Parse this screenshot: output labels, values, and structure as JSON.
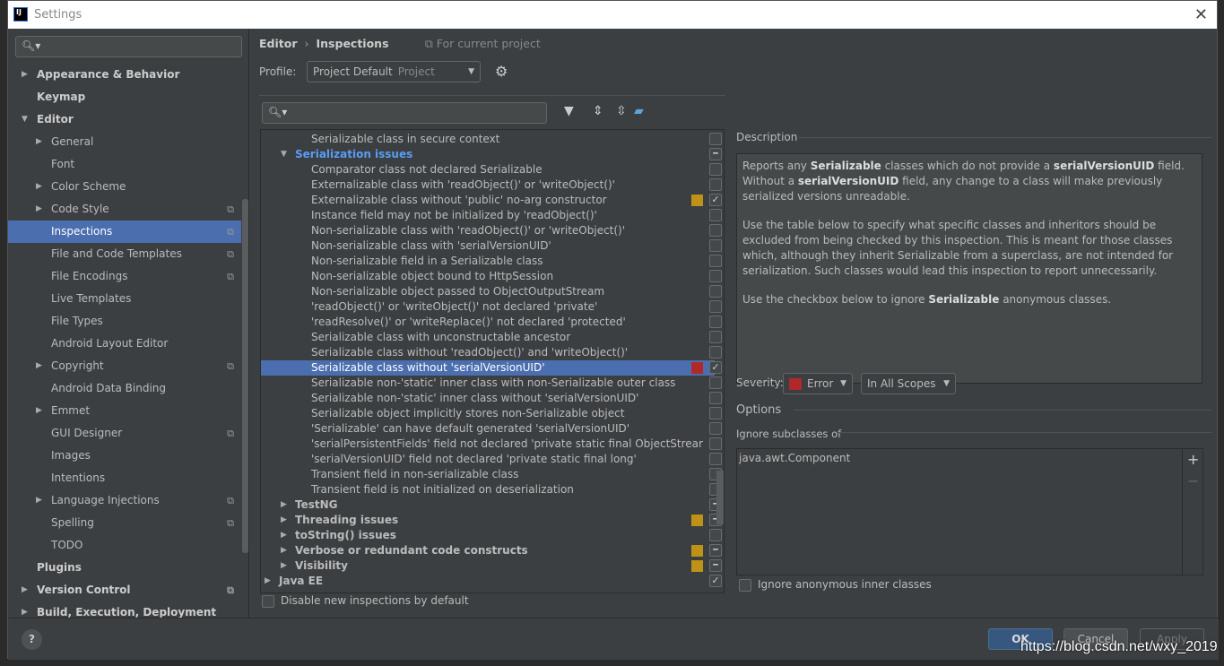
{
  "window": {
    "title": "Settings",
    "logo": "IJ"
  },
  "sidebar": {
    "items": [
      {
        "label": "Appearance & Behavior",
        "level": 0,
        "arrow": "right"
      },
      {
        "label": "Keymap",
        "level": 0
      },
      {
        "label": "Editor",
        "level": 0,
        "arrow": "down"
      },
      {
        "label": "General",
        "level": 1,
        "arrow": "right"
      },
      {
        "label": "Font",
        "level": 1
      },
      {
        "label": "Color Scheme",
        "level": 1,
        "arrow": "right"
      },
      {
        "label": "Code Style",
        "level": 1,
        "arrow": "right",
        "project": true
      },
      {
        "label": "Inspections",
        "level": 1,
        "project": true,
        "selected": true
      },
      {
        "label": "File and Code Templates",
        "level": 1,
        "project": true
      },
      {
        "label": "File Encodings",
        "level": 1,
        "project": true
      },
      {
        "label": "Live Templates",
        "level": 1
      },
      {
        "label": "File Types",
        "level": 1
      },
      {
        "label": "Android Layout Editor",
        "level": 1
      },
      {
        "label": "Copyright",
        "level": 1,
        "arrow": "right",
        "project": true
      },
      {
        "label": "Android Data Binding",
        "level": 1
      },
      {
        "label": "Emmet",
        "level": 1,
        "arrow": "right"
      },
      {
        "label": "GUI Designer",
        "level": 1,
        "project": true
      },
      {
        "label": "Images",
        "level": 1
      },
      {
        "label": "Intentions",
        "level": 1
      },
      {
        "label": "Language Injections",
        "level": 1,
        "arrow": "right",
        "project": true
      },
      {
        "label": "Spelling",
        "level": 1,
        "project": true
      },
      {
        "label": "TODO",
        "level": 1
      },
      {
        "label": "Plugins",
        "level": 0
      },
      {
        "label": "Version Control",
        "level": 0,
        "arrow": "right",
        "project": true
      },
      {
        "label": "Build, Execution, Deployment",
        "level": 0,
        "arrow": "right"
      }
    ]
  },
  "header": {
    "crumb1": "Editor",
    "crumb2": "Inspections",
    "for_project": "For current project"
  },
  "profile": {
    "label": "Profile:",
    "value": "Project Default",
    "sub": "Project"
  },
  "colors": {
    "warning": "#be9117",
    "error": "#b0282a",
    "accent": "#4b6eaf",
    "link": "#589df6"
  },
  "tree": [
    {
      "label": "Serializable class in secure context",
      "depth": 2,
      "check": "empty"
    },
    {
      "label": "Serialization issues",
      "depth": 1,
      "arrow": "down",
      "check": "partial",
      "highlight": true
    },
    {
      "label": "Comparator class not declared Serializable",
      "depth": 2,
      "check": "empty"
    },
    {
      "label": "Externalizable class with 'readObject()' or 'writeObject()'",
      "depth": 2,
      "check": "empty"
    },
    {
      "label": "Externalizable class without 'public' no-arg constructor",
      "depth": 2,
      "check": "checked",
      "severity": "warning"
    },
    {
      "label": "Instance field may not be initialized by 'readObject()'",
      "depth": 2,
      "check": "empty"
    },
    {
      "label": "Non-serializable class with 'readObject()' or 'writeObject()'",
      "depth": 2,
      "check": "empty"
    },
    {
      "label": "Non-serializable class with 'serialVersionUID'",
      "depth": 2,
      "check": "empty"
    },
    {
      "label": "Non-serializable field in a Serializable class",
      "depth": 2,
      "check": "empty"
    },
    {
      "label": "Non-serializable object bound to HttpSession",
      "depth": 2,
      "check": "empty"
    },
    {
      "label": "Non-serializable object passed to ObjectOutputStream",
      "depth": 2,
      "check": "empty"
    },
    {
      "label": "'readObject()' or 'writeObject()' not declared 'private'",
      "depth": 2,
      "check": "empty"
    },
    {
      "label": "'readResolve()' or 'writeReplace()' not declared 'protected'",
      "depth": 2,
      "check": "empty"
    },
    {
      "label": "Serializable class with unconstructable ancestor",
      "depth": 2,
      "check": "empty"
    },
    {
      "label": "Serializable class without 'readObject()' and 'writeObject()'",
      "depth": 2,
      "check": "empty"
    },
    {
      "label": "Serializable class without 'serialVersionUID'",
      "depth": 2,
      "check": "checked",
      "severity": "error",
      "selected": true
    },
    {
      "label": "Serializable non-'static' inner class with non-Serializable outer class",
      "depth": 2,
      "check": "empty"
    },
    {
      "label": "Serializable non-'static' inner class without 'serialVersionUID'",
      "depth": 2,
      "check": "empty"
    },
    {
      "label": "Serializable object implicitly stores non-Serializable object",
      "depth": 2,
      "check": "empty"
    },
    {
      "label": "'Serializable' can have default generated 'serialVersionUID'",
      "depth": 2,
      "check": "empty"
    },
    {
      "label": "'serialPersistentFields' field not declared 'private static final ObjectStrear",
      "depth": 2,
      "check": "empty"
    },
    {
      "label": "'serialVersionUID' field not declared 'private static final long'",
      "depth": 2,
      "check": "empty"
    },
    {
      "label": "Transient field in non-serializable class",
      "depth": 2,
      "check": "empty"
    },
    {
      "label": "Transient field is not initialized on deserialization",
      "depth": 2,
      "check": "empty"
    },
    {
      "label": "TestNG",
      "depth": 1,
      "arrow": "right",
      "check": "partial"
    },
    {
      "label": "Threading issues",
      "depth": 1,
      "arrow": "right",
      "check": "partial",
      "severity": "warning"
    },
    {
      "label": "toString() issues",
      "depth": 1,
      "arrow": "right",
      "check": "empty"
    },
    {
      "label": "Verbose or redundant code constructs",
      "depth": 1,
      "arrow": "right",
      "check": "partial",
      "severity": "warning"
    },
    {
      "label": "Visibility",
      "depth": 1,
      "arrow": "right",
      "check": "partial",
      "severity": "warning"
    },
    {
      "label": "Java EE",
      "depth": 0,
      "arrow": "right",
      "check": "checked"
    }
  ],
  "disable_new": "Disable new inspections by default",
  "description": {
    "label": "Description",
    "p1": [
      "Reports any ",
      "Serializable",
      " classes which do not provide a ",
      "serialVersionUID",
      " field. Without a ",
      "serialVersionUID",
      " field, any change to a class will make previously serialized versions unreadable."
    ],
    "p2": "Use the table below to specify what specific classes and inheritors should be excluded from being checked by this inspection. This is meant for those classes which, although they inherit Serializable from a superclass, are not intended for serialization. Such classes would lead this inspection to report unnecessarily.",
    "p3": [
      "Use the checkbox below to ignore ",
      "Serializable",
      " anonymous classes."
    ]
  },
  "severity": {
    "label": "Severity:",
    "value": "Error",
    "scope": "In All Scopes"
  },
  "options": {
    "label": "Options",
    "ignore_label": "Ignore subclasses of",
    "items": [
      "java.awt.Component"
    ],
    "anon": "Ignore anonymous inner classes"
  },
  "footer": {
    "help": "?",
    "ok": "OK",
    "cancel": "Cancel",
    "apply": "Apply"
  },
  "watermark": "https://blog.csdn.net/wxy_2019"
}
